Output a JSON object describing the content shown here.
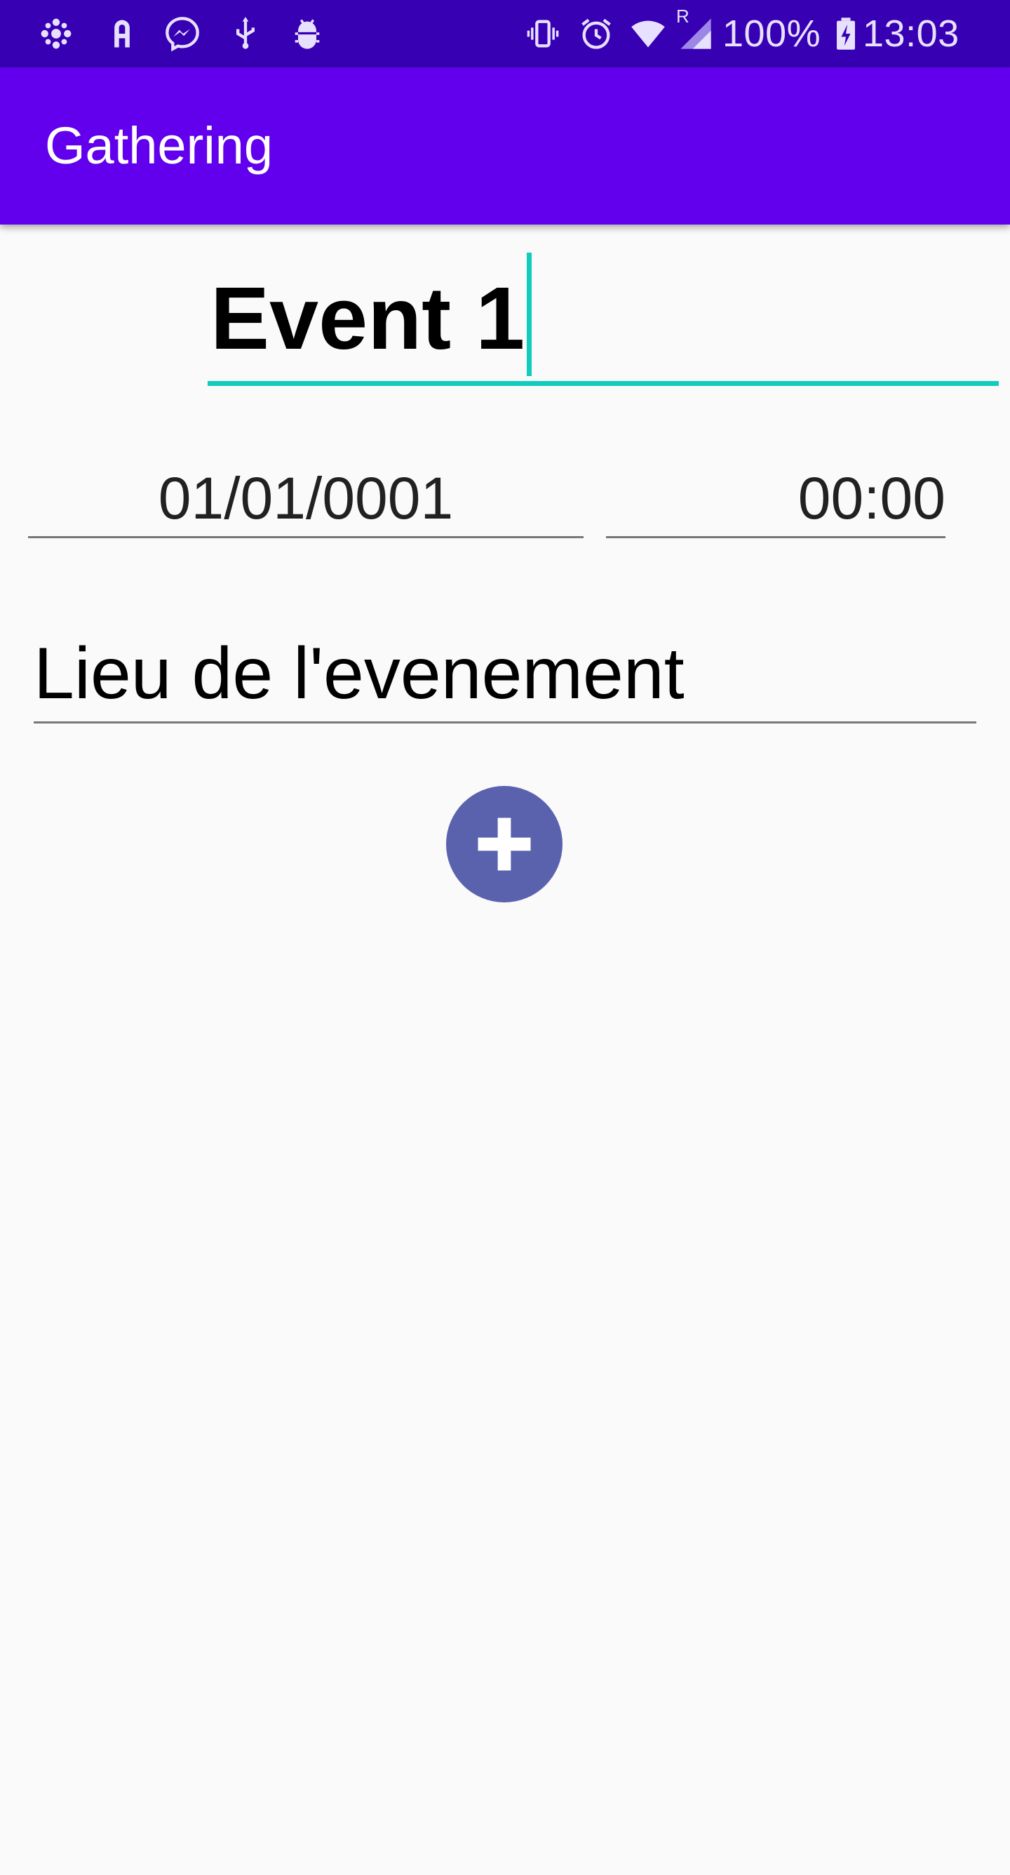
{
  "status_bar": {
    "left_icons": [
      "cbc-icon",
      "text-a-icon",
      "messenger-icon",
      "usb-icon",
      "android-debug-icon"
    ],
    "right_icons": [
      "vibrate-icon",
      "alarm-icon",
      "wifi-icon",
      "signal-icon",
      "battery-charging-icon"
    ],
    "roaming_label": "R",
    "battery": "100%",
    "time": "13:03",
    "background_color": "#3700b3"
  },
  "app_bar": {
    "title": "Gathering",
    "background_color": "#6200ee"
  },
  "form": {
    "event_name": "Event 1",
    "accent_color": "#11ccbe",
    "date": "01/01/0001",
    "time": "00:00",
    "location": "Lieu de l'evenement",
    "add_button_icon": "plus-icon",
    "add_button_color": "#5a62ad"
  }
}
